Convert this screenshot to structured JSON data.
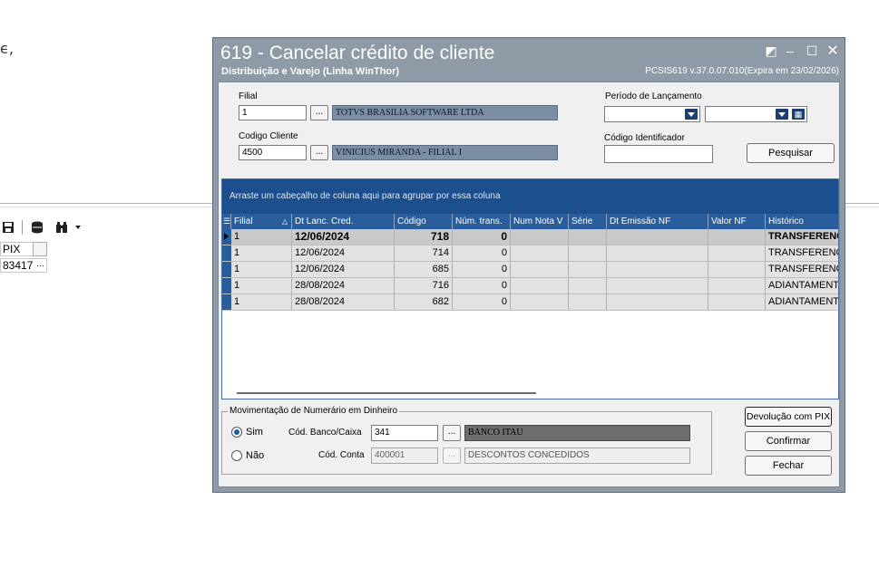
{
  "background": {
    "comma_fragment": "ϵ,",
    "cell1": "PIX",
    "cell2": "83417",
    "cell2_btn": "···"
  },
  "window": {
    "title": "619 - Cancelar crédito de cliente",
    "subtitle": "Distribuição e Varejo (Linha WinThor)",
    "version": "PCSIS619  v.37.0.07.010(Expira em 23/02/2026)",
    "controls": [
      "◩",
      "–",
      "☐",
      "✕"
    ]
  },
  "form": {
    "filial_label": "Filial",
    "filial_value": "1",
    "filial_name": "TOTVS BRASILIA SOFTWARE LTDA",
    "cliente_label": "Codigo Cliente",
    "cliente_value": "4500",
    "cliente_name": "VINICIUS MIRANDA - FILIAL I",
    "periodo_label": "Período de Lançamento",
    "periodo_start": "",
    "periodo_end": "",
    "codigo_ident_label": "Código Identificador",
    "codigo_ident_value": "",
    "pesquisar_button": "Pesquisar",
    "dots_label": "..."
  },
  "grid": {
    "group_hint": "Arraste um cabeçalho de coluna aqui para agrupar por essa coluna",
    "columns": [
      "Filial",
      "Dt Lanc. Cred.",
      "Código",
      "Núm. trans.",
      "Num Nota V",
      "Série",
      "Dt Emissão NF",
      "Valor NF",
      "Histórico"
    ],
    "rows": [
      {
        "filial": "1",
        "dt": "12/06/2024",
        "codigo": "718",
        "trans": "0",
        "hist": "TRANSFERENC"
      },
      {
        "filial": "1",
        "dt": "12/06/2024",
        "codigo": "714",
        "trans": "0",
        "hist": "TRANSFERENCIA"
      },
      {
        "filial": "1",
        "dt": "12/06/2024",
        "codigo": "685",
        "trans": "0",
        "hist": "TRANSFERENCIA"
      },
      {
        "filial": "1",
        "dt": "28/08/2024",
        "codigo": "716",
        "trans": "0",
        "hist": "ADIANTAMENTO"
      },
      {
        "filial": "1",
        "dt": "28/08/2024",
        "codigo": "682",
        "trans": "0",
        "hist": "ADIANTAMENTO"
      }
    ]
  },
  "movimentacao": {
    "title": "Movimentação de Numerário em Dinheiro",
    "sim_label": "Sim",
    "nao_label": "Não",
    "banco_label": "Cód. Banco/Caixa",
    "banco_value": "341",
    "banco_name": "BANCO ITAU",
    "conta_label": "Cód. Conta",
    "conta_value": "400001",
    "conta_name": "DESCONTOS CONCEDIDOS"
  },
  "actions": {
    "devolucao_pix": "Devolução com PIX",
    "confirmar": "Confirmar",
    "fechar": "Fechar"
  },
  "colors": {
    "title_bar": "#8e9aa6",
    "grid_header": "#2a5d9c",
    "group_panel": "#1c4f8e",
    "readonly_desc": "#7c8ea3",
    "banco_desc": "#6d6d6d"
  }
}
